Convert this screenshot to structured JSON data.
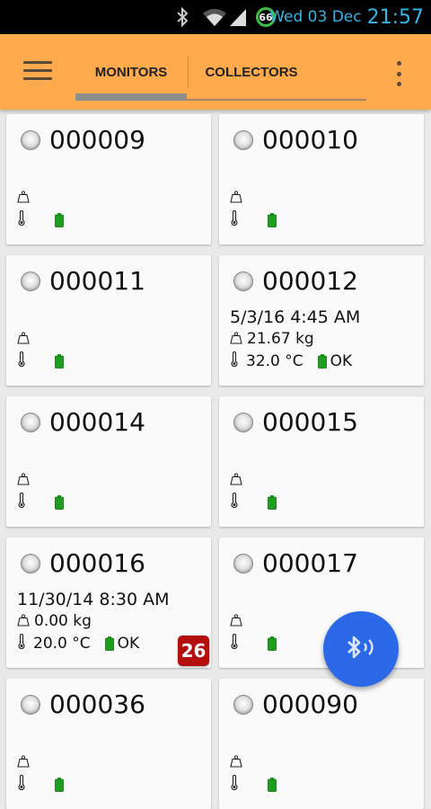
{
  "status_bar": {
    "battery_percent": "66",
    "date": "Wed 03 Dec",
    "time": "21:57",
    "icons": [
      "bluetooth-icon",
      "wifi-icon",
      "cell-signal-icon",
      "battery-ring-icon"
    ]
  },
  "app_bar": {
    "menu_icon": "hamburger-menu-icon",
    "overflow_icon": "overflow-menu-icon",
    "tabs": [
      {
        "label": "MONITORS",
        "selected": true
      },
      {
        "label": "COLLECTORS",
        "selected": false
      }
    ]
  },
  "monitors": [
    {
      "id": "000009",
      "date": "",
      "weight": "",
      "temp": "",
      "battery": ""
    },
    {
      "id": "000010",
      "date": "",
      "weight": "",
      "temp": "",
      "battery": ""
    },
    {
      "id": "000011",
      "date": "",
      "weight": "",
      "temp": "",
      "battery": ""
    },
    {
      "id": "000012",
      "date": "5/3/16 4:45 AM",
      "weight": "21.67 kg",
      "temp": "32.0 °C",
      "battery": "OK"
    },
    {
      "id": "000014",
      "date": "",
      "weight": "",
      "temp": "",
      "battery": ""
    },
    {
      "id": "000015",
      "date": "",
      "weight": "",
      "temp": "",
      "battery": ""
    },
    {
      "id": "000016",
      "date": "11/30/14 8:30 AM",
      "weight": "0.00 kg",
      "temp": "20.0 °C",
      "battery": "OK",
      "badge": "26"
    },
    {
      "id": "000017",
      "date": "",
      "weight": "",
      "temp": "",
      "battery": ""
    },
    {
      "id": "000036",
      "date": "",
      "weight": "",
      "temp": "",
      "battery": ""
    },
    {
      "id": "000090",
      "date": "",
      "weight": "",
      "temp": "",
      "battery": ""
    }
  ],
  "fab": {
    "icon": "bluetooth-scan-icon"
  },
  "colors": {
    "app_bar": "#ffab4d",
    "background": "#e9e9e9",
    "badge": "#b40f0f",
    "fab": "#2c69e8",
    "battery_green": "#1e9e1e",
    "status_text": "#33b5e5"
  }
}
